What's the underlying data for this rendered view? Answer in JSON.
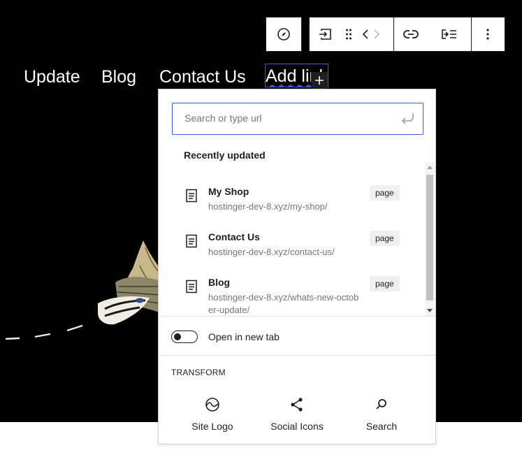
{
  "nav": {
    "items": [
      "Update",
      "Blog",
      "Contact Us"
    ],
    "editing_item": "Add link"
  },
  "toolbar": {
    "icons": [
      "compass-icon",
      "submenu-icon",
      "drag-handle-icon",
      "chevron-left-icon",
      "chevron-right-icon",
      "link-icon",
      "list-indent-icon",
      "more-vertical-icon"
    ]
  },
  "link_popover": {
    "search_placeholder": "Search or type url",
    "search_value": "",
    "recent_title": "Recently updated",
    "results": [
      {
        "title": "My Shop",
        "url": "hostinger-dev-8.xyz/my-shop/",
        "badge": "page"
      },
      {
        "title": "Contact Us",
        "url": "hostinger-dev-8.xyz/contact-us/",
        "badge": "page"
      },
      {
        "title": "Blog",
        "url": "hostinger-dev-8.xyz/whats-new-october-update/",
        "badge": "page"
      }
    ],
    "new_tab_label": "Open in new tab",
    "new_tab_checked": false,
    "transform_title": "TRANSFORM",
    "transforms": [
      {
        "label": "Site Logo",
        "icon": "site-logo-icon"
      },
      {
        "label": "Social Icons",
        "icon": "share-icon"
      },
      {
        "label": "Search",
        "icon": "search-icon"
      }
    ]
  },
  "colors": {
    "canvas": "#000000",
    "accent": "#3858e9",
    "text": "#1e1e1e",
    "muted": "#757575"
  }
}
